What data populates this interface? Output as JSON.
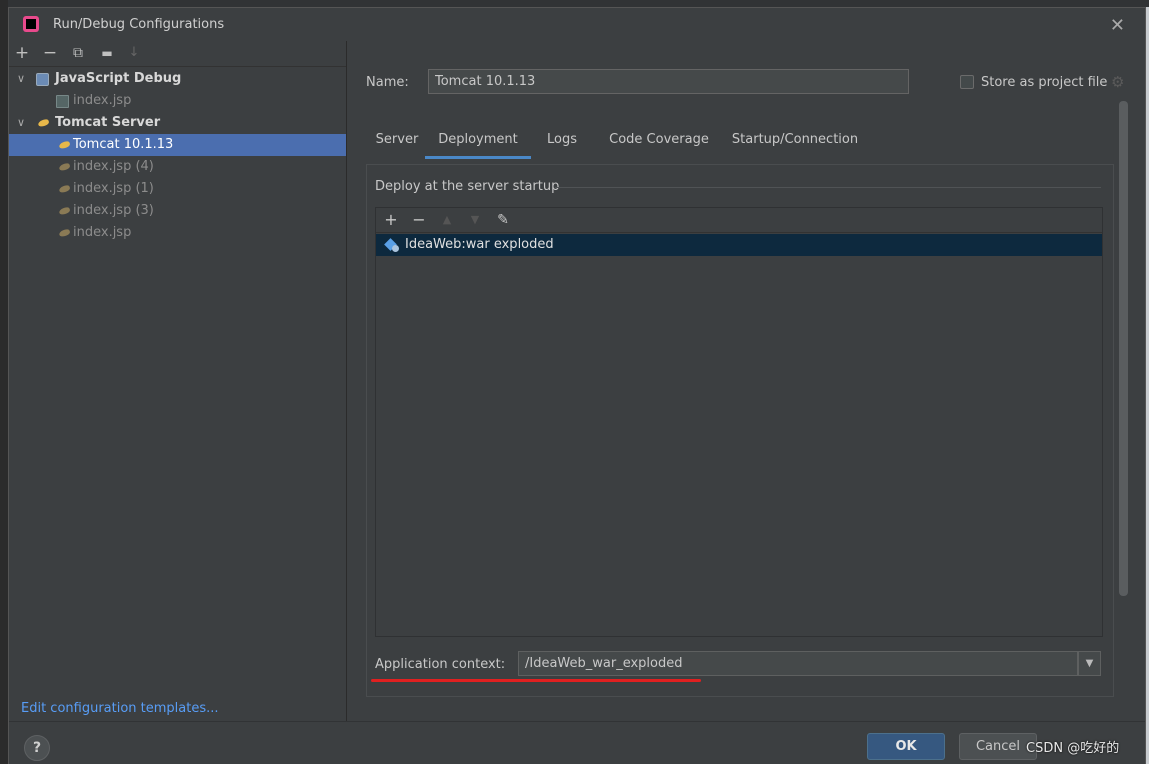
{
  "window": {
    "title": "Run/Debug Configurations"
  },
  "toolbar": {
    "add": "+",
    "remove": "−",
    "copy": "⧉",
    "folder": "▬",
    "sort": "↓"
  },
  "tree": {
    "items": [
      {
        "label": "JavaScript Debug",
        "level": 0,
        "icon": "javascript-debug-icon",
        "expanded": true
      },
      {
        "label": "index.jsp",
        "level": 1,
        "icon": "jsp-file-icon"
      },
      {
        "label": "Tomcat Server",
        "level": 0,
        "icon": "tomcat-icon",
        "expanded": true
      },
      {
        "label": "Tomcat 10.1.13",
        "level": 1,
        "icon": "tomcat-icon",
        "selected": true
      },
      {
        "label": "index.jsp (4)",
        "level": 1,
        "icon": "tomcat-icon"
      },
      {
        "label": "index.jsp (1)",
        "level": 1,
        "icon": "tomcat-icon"
      },
      {
        "label": "index.jsp (3)",
        "level": 1,
        "icon": "tomcat-icon"
      },
      {
        "label": "index.jsp",
        "level": 1,
        "icon": "tomcat-icon"
      }
    ]
  },
  "edit_templates": "Edit configuration templates...",
  "config": {
    "name_label": "Name:",
    "name_value": "Tomcat 10.1.13",
    "store_label": "Store as project file",
    "store_checked": false
  },
  "tabs": [
    {
      "label": "Server"
    },
    {
      "label": "Deployment",
      "active": true
    },
    {
      "label": "Logs"
    },
    {
      "label": "Code Coverage"
    },
    {
      "label": "Startup/Connection"
    }
  ],
  "deployment": {
    "section_title": "Deploy at the server startup",
    "artifacts": [
      {
        "label": "IdeaWeb:war exploded"
      }
    ],
    "context_label": "Application context:",
    "context_value": "/IdeaWeb_war_exploded"
  },
  "buttons": {
    "help": "?",
    "ok": "OK",
    "cancel": "Cancel"
  },
  "watermark": "CSDN @吃好的",
  "colors": {
    "background": "#3c3f41",
    "selection": "#4b6eaf",
    "tab_underline": "#4a88c7",
    "link": "#589df6",
    "ok_button": "#365880",
    "annotation_red": "#e02020"
  }
}
